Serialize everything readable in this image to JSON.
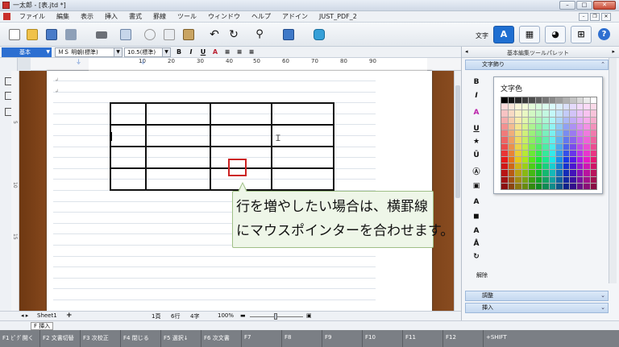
{
  "window": {
    "title": "一太郎 - [表.jtd *]"
  },
  "menu": {
    "items": [
      "ファイル",
      "編集",
      "表示",
      "挿入",
      "書式",
      "罫線",
      "ツール",
      "ウィンドウ",
      "ヘルプ",
      "アドイン",
      "JUST_PDF_2"
    ]
  },
  "toolbar": {
    "mode_label": "文字",
    "modes": [
      "A",
      "▦",
      "◕",
      "⊞"
    ],
    "help": "?"
  },
  "format": {
    "style": "基本",
    "font": "ＭＳ 明朝(標準)",
    "size": "10.5(標準)",
    "buttons": [
      "B",
      "I",
      "U",
      "A"
    ]
  },
  "ruler": {
    "ticks": [
      "10",
      "20",
      "30",
      "40",
      "50",
      "60",
      "70",
      "80",
      "90"
    ]
  },
  "vruler": {
    "ticks": [
      "5",
      "10",
      "15"
    ]
  },
  "document": {
    "callout_lines": [
      "行を増やしたい場合は、横罫線",
      "にマウスポインターを合わせます。"
    ]
  },
  "status": {
    "sheet": "Sheet1",
    "add": "+",
    "page": "1頁",
    "line": "6行",
    "col": "4字",
    "zoom": "100%"
  },
  "insert_mode": {
    "label": "F",
    "text": "挿入"
  },
  "fkeys": [
    "F1 ﾋﾟｸﾞ開く",
    "F2 文書切替",
    "F3 次校正",
    "F4 閉じる",
    "F5 選択↓",
    "F6 次文書",
    "F7",
    "F8",
    "F9",
    "F10",
    "F11",
    "F12",
    "+SHIFT"
  ],
  "panel": {
    "title": "基本編集ツールパレット",
    "section_top": "文字飾り",
    "popup_title": "文字色",
    "clear_label": "解除",
    "section_adjust": "調整",
    "section_insert": "挿入"
  },
  "colors": {
    "accent": "#1f6fd1",
    "highlight": "#cc2222",
    "callout_bg": "#eef6e8"
  }
}
